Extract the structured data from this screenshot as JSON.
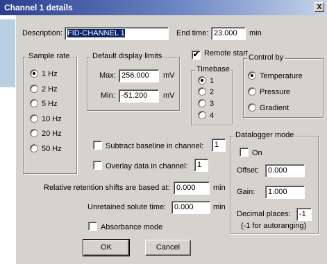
{
  "window": {
    "title": "Channel 1 details",
    "close_glyph": "X"
  },
  "description": {
    "label": "Description:",
    "value": "FID-CHANNEL 1"
  },
  "end_time": {
    "label": "End time:",
    "value": "23.000",
    "unit": "min"
  },
  "sample_rate": {
    "label": "Sample rate",
    "options": [
      "1 Hz",
      "2 Hz",
      "5 Hz",
      "10 Hz",
      "20 Hz",
      "50 Hz"
    ],
    "selected": "1 Hz"
  },
  "display_limits": {
    "label": "Default display limits",
    "max_label": "Max:",
    "max_value": "256.000",
    "min_label": "Min:",
    "min_value": "-51.200",
    "unit": "mV"
  },
  "remote_start": {
    "label": "Remote start",
    "checked": true,
    "mark": "✔"
  },
  "timebase": {
    "label": "Timebase",
    "options": [
      "1",
      "2",
      "3",
      "4"
    ],
    "selected": "1"
  },
  "control_by": {
    "label": "Control by",
    "options": [
      "Temperature",
      "Pressure",
      "Gradient"
    ],
    "selected": "Temperature"
  },
  "subtract_baseline": {
    "label": "Subtract baseline in channel:",
    "value": "1",
    "checked": false
  },
  "overlay_data": {
    "label": "Overlay data in channel:",
    "value": "1",
    "checked": false
  },
  "retention_shifts": {
    "label": "Relative retention shifts are based at:",
    "value": "0.000",
    "unit": "min"
  },
  "unretained_time": {
    "label": "Unretained solute time:",
    "value": "0.000",
    "unit": "min"
  },
  "absorbance_mode": {
    "label": "Absorbance mode",
    "checked": false
  },
  "datalogger": {
    "label": "Datalogger mode",
    "on_label": "On",
    "on_checked": false,
    "offset_label": "Offset:",
    "offset_value": "0.000",
    "gain_label": "Gain:",
    "gain_value": "1.000",
    "decimal_label": "Decimal places:",
    "decimal_value": "-1",
    "note": "(-1 for autoranging)"
  },
  "buttons": {
    "ok": "OK",
    "cancel": "Cancel"
  },
  "colors": {
    "titlebar": "#2b3f8f",
    "dialog": "#d6d3ce",
    "selection": "#0a246a"
  }
}
